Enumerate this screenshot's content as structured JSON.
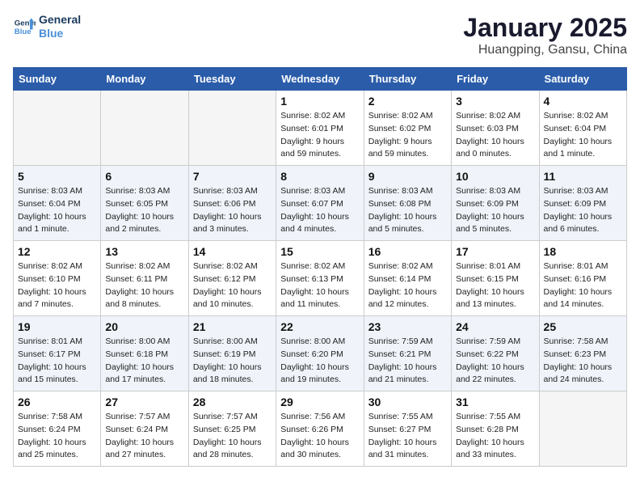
{
  "header": {
    "logo_line1": "General",
    "logo_line2": "Blue",
    "title": "January 2025",
    "subtitle": "Huangping, Gansu, China"
  },
  "weekdays": [
    "Sunday",
    "Monday",
    "Tuesday",
    "Wednesday",
    "Thursday",
    "Friday",
    "Saturday"
  ],
  "weeks": [
    [
      {
        "day": "",
        "info": ""
      },
      {
        "day": "",
        "info": ""
      },
      {
        "day": "",
        "info": ""
      },
      {
        "day": "1",
        "info": "Sunrise: 8:02 AM\nSunset: 6:01 PM\nDaylight: 9 hours\nand 59 minutes."
      },
      {
        "day": "2",
        "info": "Sunrise: 8:02 AM\nSunset: 6:02 PM\nDaylight: 9 hours\nand 59 minutes."
      },
      {
        "day": "3",
        "info": "Sunrise: 8:02 AM\nSunset: 6:03 PM\nDaylight: 10 hours\nand 0 minutes."
      },
      {
        "day": "4",
        "info": "Sunrise: 8:02 AM\nSunset: 6:04 PM\nDaylight: 10 hours\nand 1 minute."
      }
    ],
    [
      {
        "day": "5",
        "info": "Sunrise: 8:03 AM\nSunset: 6:04 PM\nDaylight: 10 hours\nand 1 minute."
      },
      {
        "day": "6",
        "info": "Sunrise: 8:03 AM\nSunset: 6:05 PM\nDaylight: 10 hours\nand 2 minutes."
      },
      {
        "day": "7",
        "info": "Sunrise: 8:03 AM\nSunset: 6:06 PM\nDaylight: 10 hours\nand 3 minutes."
      },
      {
        "day": "8",
        "info": "Sunrise: 8:03 AM\nSunset: 6:07 PM\nDaylight: 10 hours\nand 4 minutes."
      },
      {
        "day": "9",
        "info": "Sunrise: 8:03 AM\nSunset: 6:08 PM\nDaylight: 10 hours\nand 5 minutes."
      },
      {
        "day": "10",
        "info": "Sunrise: 8:03 AM\nSunset: 6:09 PM\nDaylight: 10 hours\nand 5 minutes."
      },
      {
        "day": "11",
        "info": "Sunrise: 8:03 AM\nSunset: 6:09 PM\nDaylight: 10 hours\nand 6 minutes."
      }
    ],
    [
      {
        "day": "12",
        "info": "Sunrise: 8:02 AM\nSunset: 6:10 PM\nDaylight: 10 hours\nand 7 minutes."
      },
      {
        "day": "13",
        "info": "Sunrise: 8:02 AM\nSunset: 6:11 PM\nDaylight: 10 hours\nand 8 minutes."
      },
      {
        "day": "14",
        "info": "Sunrise: 8:02 AM\nSunset: 6:12 PM\nDaylight: 10 hours\nand 10 minutes."
      },
      {
        "day": "15",
        "info": "Sunrise: 8:02 AM\nSunset: 6:13 PM\nDaylight: 10 hours\nand 11 minutes."
      },
      {
        "day": "16",
        "info": "Sunrise: 8:02 AM\nSunset: 6:14 PM\nDaylight: 10 hours\nand 12 minutes."
      },
      {
        "day": "17",
        "info": "Sunrise: 8:01 AM\nSunset: 6:15 PM\nDaylight: 10 hours\nand 13 minutes."
      },
      {
        "day": "18",
        "info": "Sunrise: 8:01 AM\nSunset: 6:16 PM\nDaylight: 10 hours\nand 14 minutes."
      }
    ],
    [
      {
        "day": "19",
        "info": "Sunrise: 8:01 AM\nSunset: 6:17 PM\nDaylight: 10 hours\nand 15 minutes."
      },
      {
        "day": "20",
        "info": "Sunrise: 8:00 AM\nSunset: 6:18 PM\nDaylight: 10 hours\nand 17 minutes."
      },
      {
        "day": "21",
        "info": "Sunrise: 8:00 AM\nSunset: 6:19 PM\nDaylight: 10 hours\nand 18 minutes."
      },
      {
        "day": "22",
        "info": "Sunrise: 8:00 AM\nSunset: 6:20 PM\nDaylight: 10 hours\nand 19 minutes."
      },
      {
        "day": "23",
        "info": "Sunrise: 7:59 AM\nSunset: 6:21 PM\nDaylight: 10 hours\nand 21 minutes."
      },
      {
        "day": "24",
        "info": "Sunrise: 7:59 AM\nSunset: 6:22 PM\nDaylight: 10 hours\nand 22 minutes."
      },
      {
        "day": "25",
        "info": "Sunrise: 7:58 AM\nSunset: 6:23 PM\nDaylight: 10 hours\nand 24 minutes."
      }
    ],
    [
      {
        "day": "26",
        "info": "Sunrise: 7:58 AM\nSunset: 6:24 PM\nDaylight: 10 hours\nand 25 minutes."
      },
      {
        "day": "27",
        "info": "Sunrise: 7:57 AM\nSunset: 6:24 PM\nDaylight: 10 hours\nand 27 minutes."
      },
      {
        "day": "28",
        "info": "Sunrise: 7:57 AM\nSunset: 6:25 PM\nDaylight: 10 hours\nand 28 minutes."
      },
      {
        "day": "29",
        "info": "Sunrise: 7:56 AM\nSunset: 6:26 PM\nDaylight: 10 hours\nand 30 minutes."
      },
      {
        "day": "30",
        "info": "Sunrise: 7:55 AM\nSunset: 6:27 PM\nDaylight: 10 hours\nand 31 minutes."
      },
      {
        "day": "31",
        "info": "Sunrise: 7:55 AM\nSunset: 6:28 PM\nDaylight: 10 hours\nand 33 minutes."
      },
      {
        "day": "",
        "info": ""
      }
    ]
  ]
}
